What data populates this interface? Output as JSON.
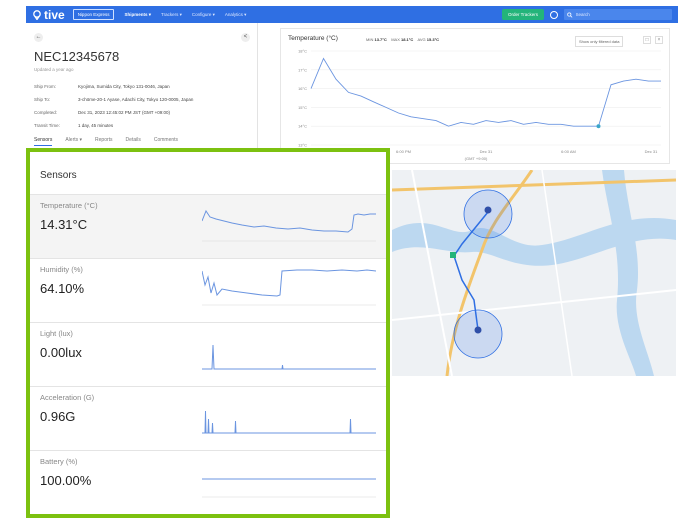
{
  "topbar": {
    "logo": "tive",
    "org_label": "Nippon Express",
    "nav": [
      "Shipments ▾",
      "Trackers ▾",
      "Configure ▾",
      "Analytics ▾"
    ],
    "order_label": "Order Trackers",
    "search_placeholder": "Search"
  },
  "shipment": {
    "id": "NEC12345678",
    "updated": "Updated a year ago",
    "rows": [
      {
        "label": "Ship From:",
        "value": "Kyojima, Sumida City, Tokyo 131-0046, Japan"
      },
      {
        "label": "Ship To:",
        "value": "3-chōme-20-1 Ayase, Adachi City, Tokyo 120-0005, Japan"
      },
      {
        "label": "Completed:",
        "value": "Dec 31, 2023 12:45:02 PM JST (GMT +09:00)"
      },
      {
        "label": "Transit Time:",
        "value": "1 day, 45 minutes"
      }
    ],
    "tabs": [
      "Sensors",
      "Alerts ▾",
      "Reports",
      "Details",
      "Comments"
    ]
  },
  "temp_chart": {
    "title": "Temperature (°C)",
    "min_label": "MIN",
    "min_value": "13.7°C",
    "max_label": "MAX",
    "max_value": "18.1°C",
    "avg_label": "AVG",
    "avg_value": "15.3°C",
    "filter_label": "Show only filtered data",
    "x_axis_caption": "(GMT +9:00)"
  },
  "chart_data": {
    "type": "line",
    "title": "Temperature (°C)",
    "xlabel": "(GMT +9:00)",
    "ylabel": "",
    "x_ticks": [
      "Dec 30",
      "6:00 PM",
      "Dec 31",
      "6:00 AM",
      "Dec 31"
    ],
    "y_ticks": [
      "13°C",
      "14°C",
      "15°C",
      "16°C",
      "17°C",
      "18°C"
    ],
    "ylim": [
      13,
      18
    ],
    "series": [
      {
        "values": [
          16.0,
          17.6,
          16.5,
          15.8,
          15.6,
          15.3,
          15.0,
          14.7,
          14.5,
          14.4,
          14.3,
          14.0,
          14.2,
          14.1,
          14.3,
          14.2,
          14.3,
          14.1,
          14.2,
          14.1,
          14.1,
          14.0,
          14.0,
          14.0,
          16.2,
          16.4,
          16.5,
          16.4,
          16.4
        ]
      }
    ]
  },
  "sensors": {
    "title": "Sensors",
    "items": [
      {
        "label": "Temperature (°C)",
        "value": "14.31°C"
      },
      {
        "label": "Humidity (%)",
        "value": "64.10%"
      },
      {
        "label": "Light (lux)",
        "value": "0.00lux"
      },
      {
        "label": "Acceleration (G)",
        "value": "0.96G"
      },
      {
        "label": "Battery (%)",
        "value": "100.00%"
      }
    ]
  },
  "colors": {
    "brand_blue": "#2f6fe3",
    "order_green": "#23b47a",
    "highlight_green": "#7cc110",
    "line_blue": "#6b95e0"
  }
}
